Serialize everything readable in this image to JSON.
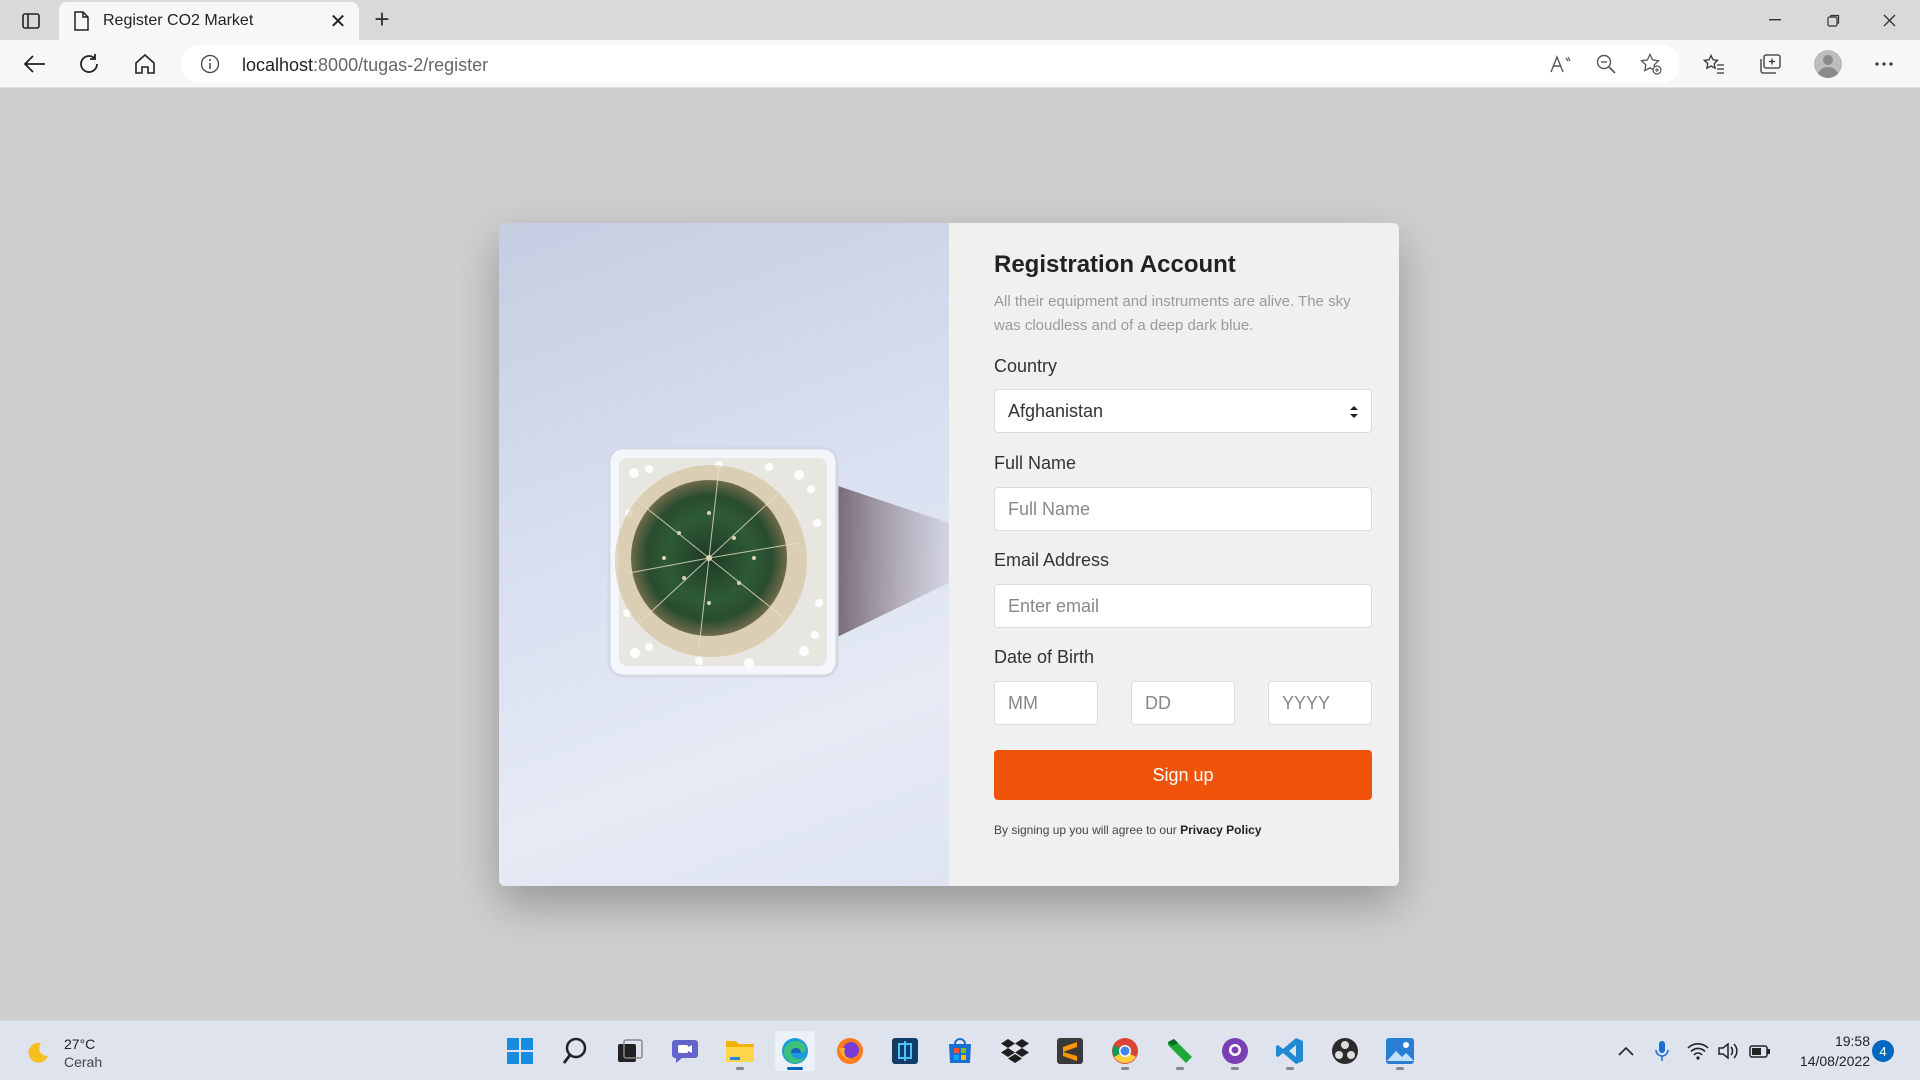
{
  "browser": {
    "tab_title": "Register CO2 Market",
    "url_host": "localhost",
    "url_rest": ":8000/tugas-2/register"
  },
  "form": {
    "title": "Registration Account",
    "subtitle": "All their equipment and instruments are alive. The sky was cloudless and of a deep dark blue.",
    "country_label": "Country",
    "country_value": "Afghanistan",
    "fullname_label": "Full Name",
    "fullname_placeholder": "Full Name",
    "email_label": "Email Address",
    "email_placeholder": "Enter email",
    "dob_label": "Date of Birth",
    "mm_placeholder": "MM",
    "dd_placeholder": "DD",
    "yyyy_placeholder": "YYYY",
    "signup_label": "Sign up",
    "terms_text": "By signing up you will agree to our ",
    "terms_link": "Privacy Policy"
  },
  "taskbar": {
    "temperature": "27°C",
    "weather_desc": "Cerah",
    "time": "19:58",
    "date": "14/08/2022",
    "notification_count": "4"
  },
  "colors": {
    "accent": "#f0540a",
    "page_bg": "#cfcfcf"
  }
}
